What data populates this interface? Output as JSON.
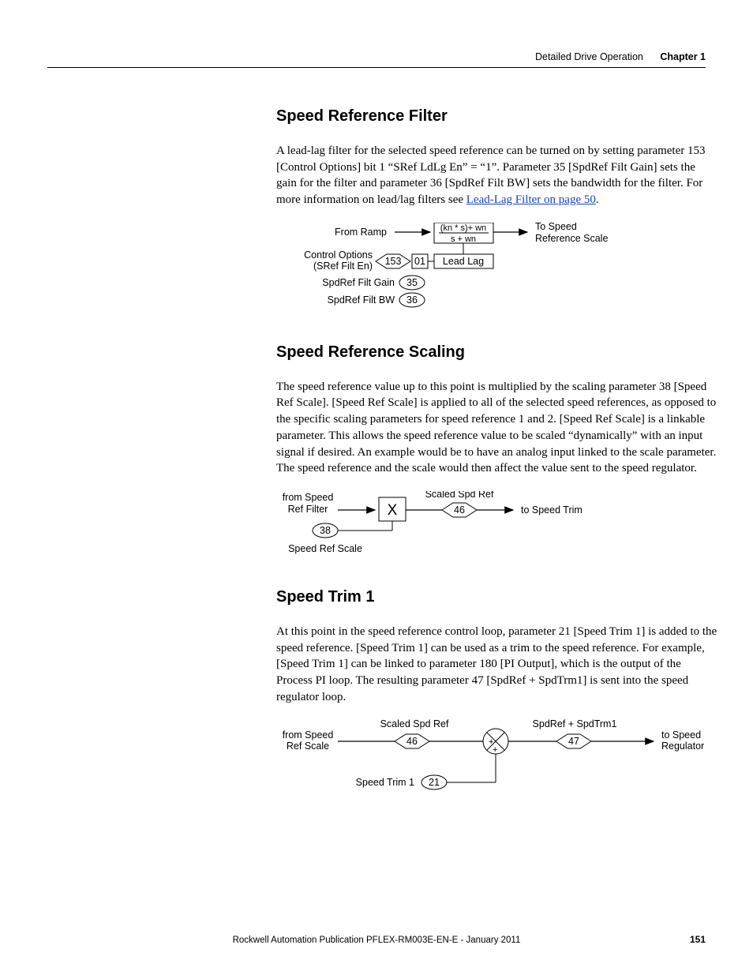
{
  "header": {
    "breadcrumb": "Detailed Drive Operation",
    "chapter": "Chapter 1"
  },
  "sections": {
    "filter": {
      "title": "Speed Reference Filter",
      "body": "A lead-lag filter for the selected speed reference can be turned on by setting parameter 153 [Control Options] bit 1 “SRef LdLg En” = “1”. Parameter 35 [SpdRef Filt Gain] sets the gain for the filter and parameter 36 [SpdRef Filt BW] sets the bandwidth for the filter. For more information on lead/lag filters see ",
      "link": "Lead-Lag Filter on page 50",
      "body_tail": "."
    },
    "scaling": {
      "title": "Speed Reference Scaling",
      "body": "The speed reference value up to this point is multiplied by the scaling parameter 38 [Speed Ref Scale]. [Speed Ref Scale] is applied to all of the selected speed references, as opposed to the specific scaling parameters for speed reference 1 and 2. [Speed Ref Scale] is a linkable parameter. This allows the speed reference value to be scaled “dynamically” with an input signal if desired. An example would be to have an analog input linked to the scale parameter. The speed reference and the scale would then affect the value sent to the speed regulator."
    },
    "trim": {
      "title": "Speed Trim 1",
      "body": "At this point in the speed reference control loop, parameter 21 [Speed Trim 1] is added to the speed reference. [Speed Trim 1] can be used as a trim to the speed reference. For example, [Speed Trim 1] can be linked to parameter 180 [PI Output], which is the output of the Process PI loop. The resulting parameter 47 [SpdRef + SpdTrm1] is sent into the speed regulator loop."
    }
  },
  "diagram1": {
    "from_ramp": "From Ramp",
    "transfer_num": "(kn * s)+ wn",
    "transfer_den": "s + wn",
    "to_speed": "To Speed",
    "ref_scale": "Reference Scale",
    "control_options": "Control Options",
    "sref_filt_en": "(SRef Filt En)",
    "p153": "153",
    "b01": "01",
    "lead_lag": "Lead Lag",
    "filt_gain": "SpdRef Filt Gain",
    "p35": "35",
    "filt_bw": "SpdRef Filt BW",
    "p36": "36"
  },
  "diagram2": {
    "from_speed": "from Speed",
    "ref_filter": "Ref Filter",
    "scaled_spd_ref": "Scaled Spd Ref",
    "x": "X",
    "p46": "46",
    "to_speed_trim": "to Speed Trim",
    "p38": "38",
    "speed_ref_scale": "Speed Ref Scale"
  },
  "diagram3": {
    "scaled_spd_ref": "Scaled Spd Ref",
    "spdref_spdtrm1": "SpdRef + SpdTrm1",
    "from_speed": "from Speed",
    "ref_scale": "Ref Scale",
    "p46": "46",
    "p47": "47",
    "to_speed": "to Speed",
    "regulator": "Regulator",
    "speed_trim_1": "Speed Trim 1",
    "p21": "21",
    "plus": "+"
  },
  "footer": {
    "text": "Rockwell Automation Publication PFLEX-RM003E-EN-E - January 2011",
    "page": "151"
  }
}
